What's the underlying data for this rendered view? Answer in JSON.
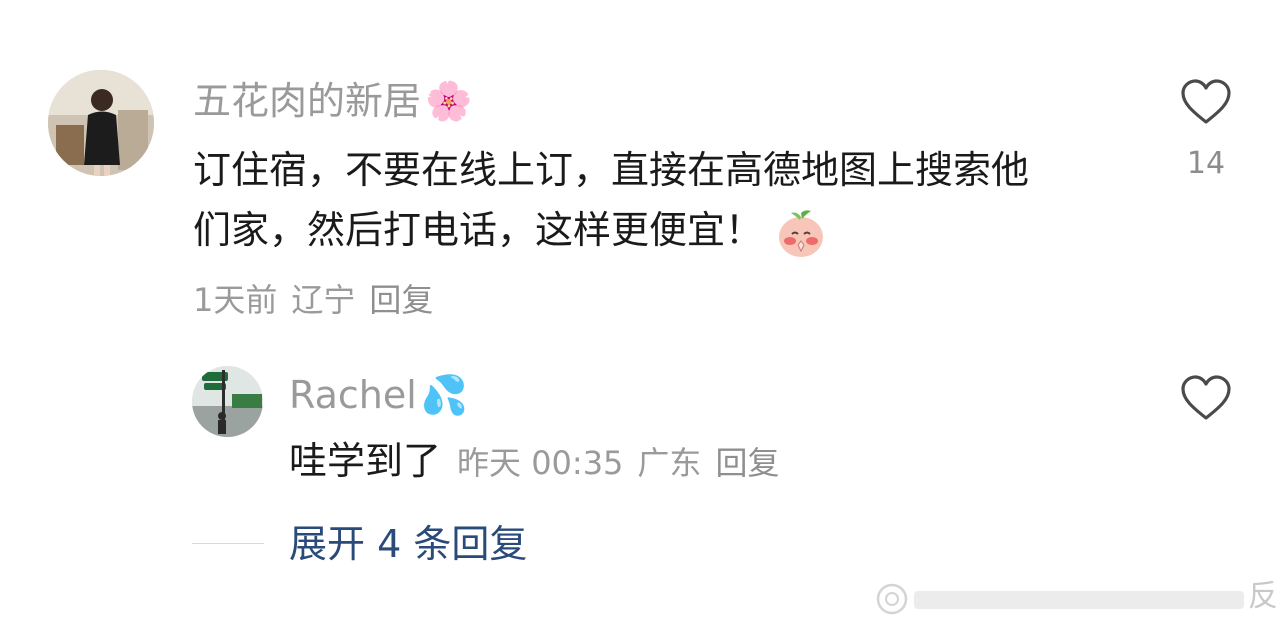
{
  "comment": {
    "username": "五花肉的新居",
    "username_emoji": "🌸",
    "text_line1": "订住宿，不要在线上订，直接在高德地图上搜索他",
    "text_line2": "们家，然后打电话，这样更便宜！",
    "time": "1天前",
    "location": "辽宁",
    "reply_label": "回复",
    "like_count": "14"
  },
  "reply": {
    "username": "Rachel",
    "username_emoji": "💦",
    "text": "哇学到了",
    "time": "昨天 00:35",
    "location": "广东",
    "reply_label": "回复"
  },
  "expand_replies": {
    "label": "展开 4 条回复"
  },
  "watermark": {
    "text": "反"
  },
  "icons": [
    "heart-outline-icon",
    "heart-outline-icon",
    "weibo-watermark-icon"
  ],
  "colors": {
    "username": "#9a9a9a",
    "text": "#1a1a1a",
    "expand_link": "#2a4a7a"
  }
}
